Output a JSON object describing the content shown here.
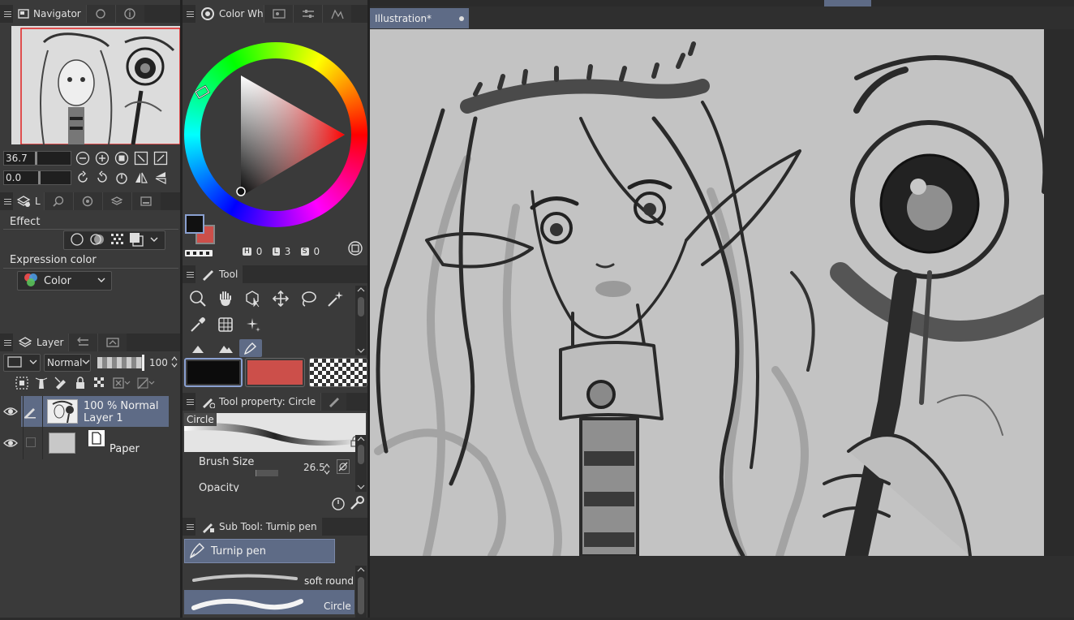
{
  "navigator": {
    "tab_label": "Navigator",
    "zoom_value": "36.7",
    "rotate_value": "0.0"
  },
  "layer_property": {
    "tab_short": "L",
    "effect_label": "Effect",
    "expression_label": "Expression color",
    "expression_value": "Color"
  },
  "layer": {
    "tab_label": "Layer",
    "blend_mode": "Normal",
    "opacity": "100",
    "layers": [
      {
        "line1": "100 % Normal",
        "line2": "Layer 1"
      },
      {
        "line1": "Paper",
        "line2": ""
      }
    ]
  },
  "color_wheel": {
    "tab_label": "Color Wh",
    "h_label": "H",
    "h_value": "0",
    "l_label": "L",
    "l_value": "3",
    "s_label": "S",
    "s_value": "0",
    "main_color": "#111111",
    "sub_color": "#cc4f4a"
  },
  "tool": {
    "tab_label": "Tool"
  },
  "tool_property": {
    "tab_label": "Tool property: Circle",
    "preview_label": "Circle",
    "brush_size_label": "Brush Size",
    "brush_size_value": "26.5",
    "opacity_label": "Opacity"
  },
  "sub_tool": {
    "tab_label": "Sub Tool: Turnip pen",
    "group_label": "Turnip pen",
    "brushes": [
      {
        "name": "soft round"
      },
      {
        "name": "Circle"
      }
    ]
  },
  "canvas": {
    "tab_label": "Illustration*"
  }
}
